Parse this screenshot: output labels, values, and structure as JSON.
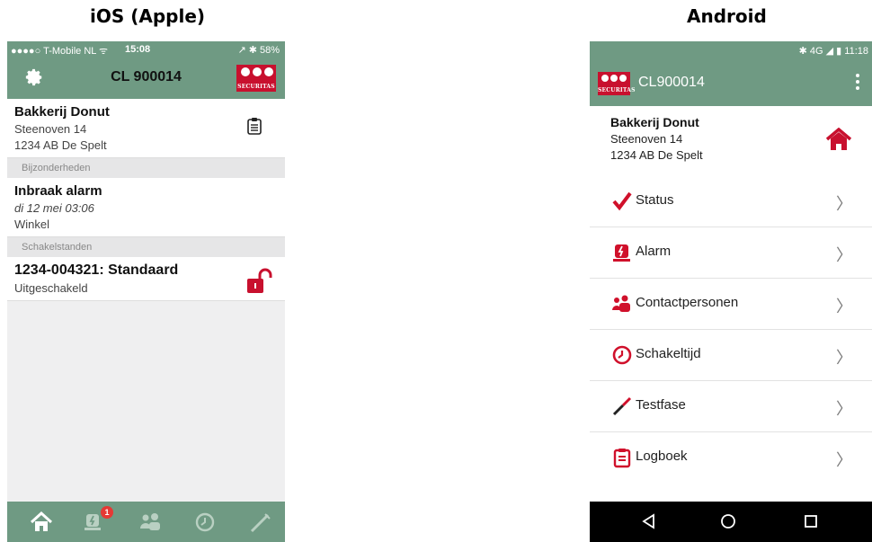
{
  "headings": {
    "ios": "iOS (Apple)",
    "android": "Android"
  },
  "ios": {
    "status": {
      "carrier": "●●●●○ T-Mobile NL ᯤ",
      "time": "15:08",
      "battery": "↗ ✱ 58%"
    },
    "title": "CL 900014",
    "logo_text": "SECURITAS",
    "customer": {
      "name": "Bakkerij Donut",
      "street": "Steenoven 14",
      "city": "1234 AB  De Spelt"
    },
    "section1": "Bijzonderheden",
    "alarm": {
      "title": "Inbraak alarm",
      "date": "di 12 mei 03:06",
      "location": "Winkel"
    },
    "section2": "Schakelstanden",
    "switch": {
      "title": "1234-004321: Standaard",
      "status": "Uitgeschakeld"
    },
    "tabbar": {
      "badge_count": "1",
      "icons": [
        "home-icon",
        "alarm-icon",
        "contacts-icon",
        "clock-icon",
        "test-icon"
      ]
    },
    "colors": {
      "bar": "#6f9a83",
      "accent": "#c8102e"
    }
  },
  "android": {
    "status": {
      "right": "✱ 4G ◢ ▮ 11:18"
    },
    "title": "CL900014",
    "logo_text": "SECURITAS",
    "customer": {
      "name": "Bakkerij Donut",
      "street": "Steenoven 14",
      "city": "1234 AB De Spelt"
    },
    "menu": [
      {
        "label": "Status",
        "icon": "checkmark-icon"
      },
      {
        "label": "Alarm",
        "icon": "alarm-icon"
      },
      {
        "label": "Contactpersonen",
        "icon": "contacts-icon"
      },
      {
        "label": "Schakeltijd",
        "icon": "clock-icon"
      },
      {
        "label": "Testfase",
        "icon": "test-icon"
      },
      {
        "label": "Logboek",
        "icon": "clipboard-icon"
      }
    ],
    "chevron": "〉",
    "navbar": [
      "back-icon",
      "home-circle-icon",
      "recents-icon"
    ]
  }
}
